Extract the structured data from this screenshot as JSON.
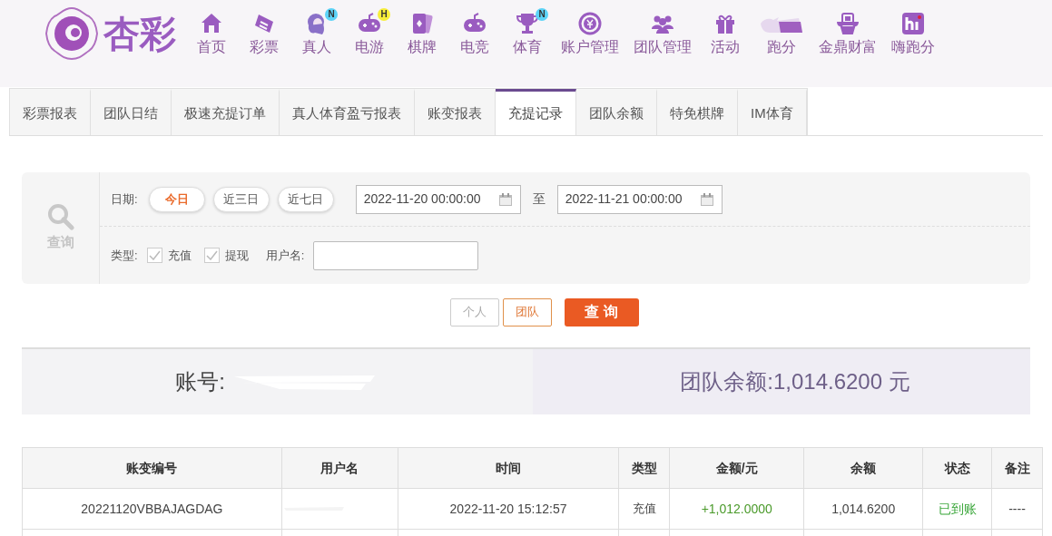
{
  "logo": {
    "text": "杏彩"
  },
  "nav": [
    {
      "label": "首页"
    },
    {
      "label": "彩票"
    },
    {
      "label": "真人",
      "badge": {
        "text": "N",
        "color": "#5cd3f7"
      }
    },
    {
      "label": "电游",
      "badge": {
        "text": "H",
        "color": "#f7ee3a"
      }
    },
    {
      "label": "棋牌"
    },
    {
      "label": "电竞"
    },
    {
      "label": "体育",
      "badge": {
        "text": "N",
        "color": "#5cd3f7"
      }
    },
    {
      "label": "账户管理"
    },
    {
      "label": "团队管理"
    },
    {
      "label": "活动"
    },
    {
      "label": "跑分"
    },
    {
      "label": "金鼎财富"
    },
    {
      "label": "嗨跑分"
    }
  ],
  "tabs": [
    {
      "label": "彩票报表",
      "selected": false
    },
    {
      "label": "团队日结",
      "selected": false
    },
    {
      "label": "极速充提订单",
      "selected": false
    },
    {
      "label": "真人体育盈亏报表",
      "selected": false
    },
    {
      "label": "账变报表",
      "selected": false
    },
    {
      "label": "充提记录",
      "selected": true
    },
    {
      "label": "团队余额",
      "selected": false
    },
    {
      "label": "特免棋牌",
      "selected": false
    },
    {
      "label": "IM体育",
      "selected": false
    }
  ],
  "filter": {
    "side_label": "查询",
    "date_label": "日期:",
    "quick_ranges": [
      {
        "label": "今日",
        "selected": true
      },
      {
        "label": "近三日",
        "selected": false
      },
      {
        "label": "近七日",
        "selected": false
      }
    ],
    "start": "2022-11-20 00:00:00",
    "to": "至",
    "end": "2022-11-21 00:00:00",
    "type_label": "类型:",
    "types": [
      {
        "label": "充值",
        "checked": true
      },
      {
        "label": "提现",
        "checked": true
      }
    ],
    "username_label": "用户名:"
  },
  "scope_buttons": [
    {
      "label": "个人",
      "selected": false
    },
    {
      "label": "团队",
      "selected": true
    }
  ],
  "search_button": "查 询",
  "summary": {
    "account_label": "账号:",
    "balance": "团队余额:1,014.6200 元"
  },
  "table": {
    "columns": [
      "账变编号",
      "用户名",
      "时间",
      "类型",
      "金额/元",
      "余额",
      "状态",
      "备注"
    ],
    "rows": [
      {
        "cells": [
          "20221120VBBAJAGDAG",
          "",
          "2022-11-20 15:12:57",
          "充值",
          "+1,012.0000",
          "1,014.6200",
          "已到账",
          "----"
        ]
      }
    ]
  }
}
